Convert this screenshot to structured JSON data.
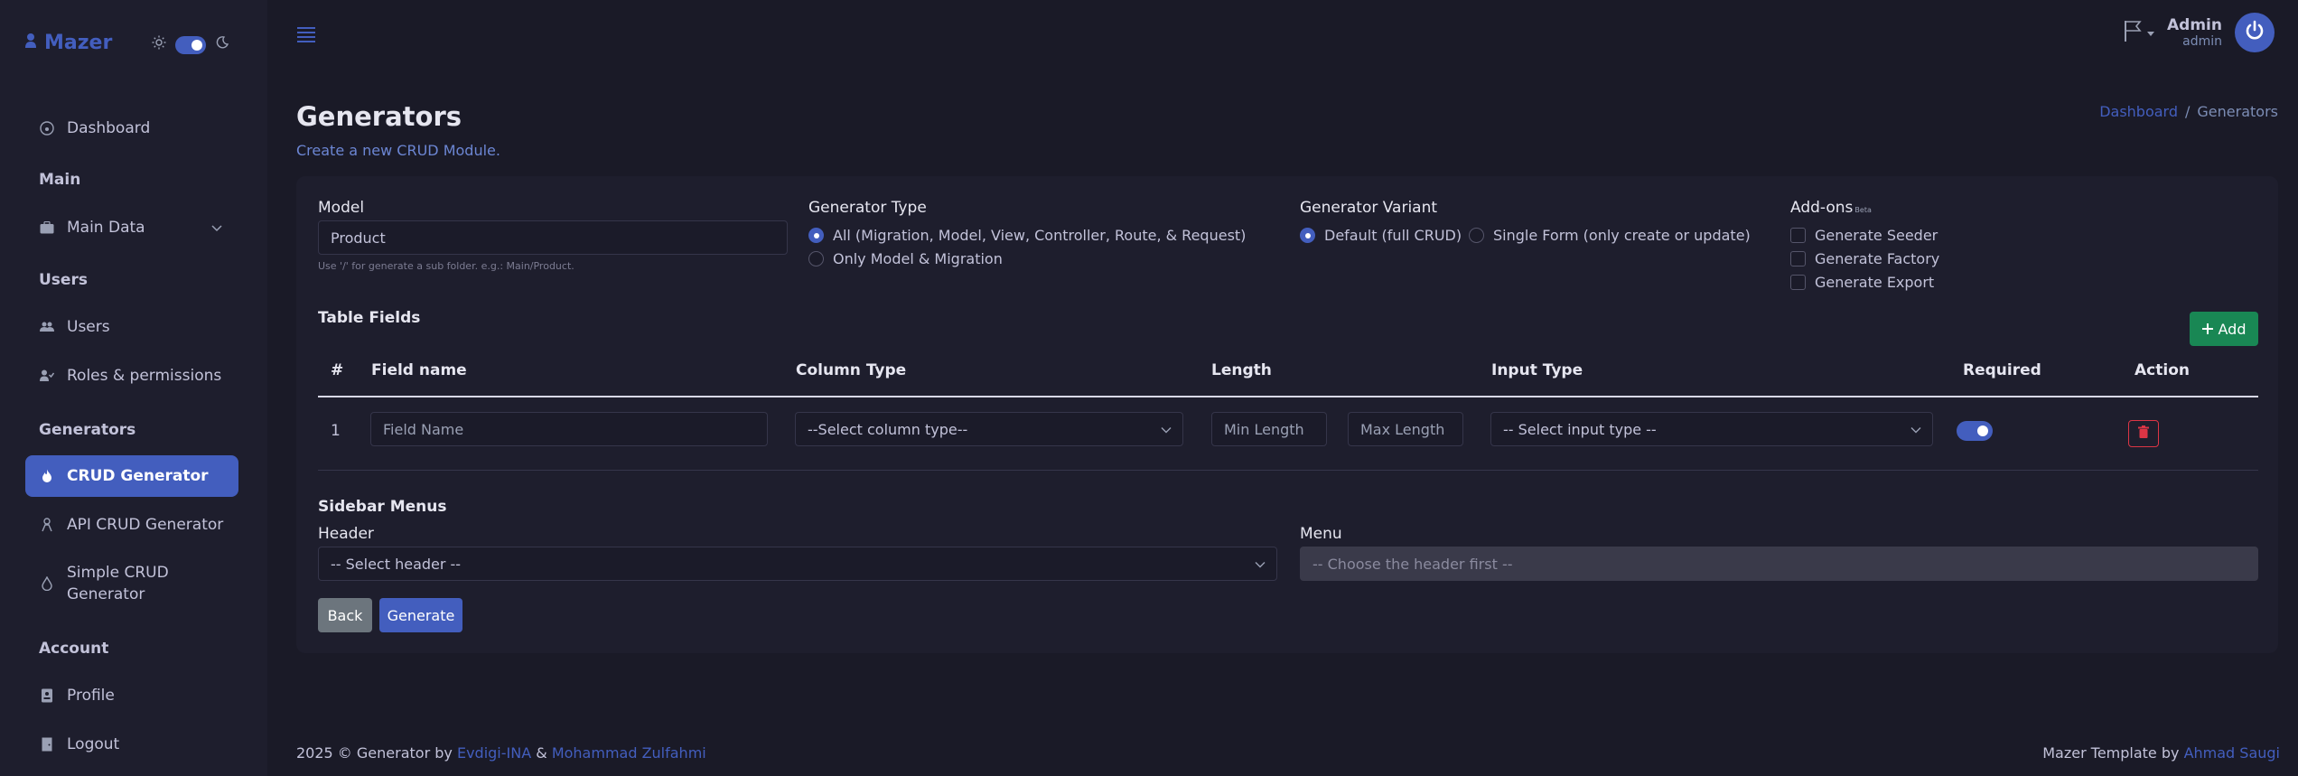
{
  "brand": {
    "name": "Mazer"
  },
  "sidebar": {
    "items": [
      {
        "label": "Dashboard"
      },
      {
        "title": "Main"
      },
      {
        "label": "Main Data"
      },
      {
        "title": "Users"
      },
      {
        "label": "Users"
      },
      {
        "label": "Roles & permissions"
      },
      {
        "title": "Generators"
      },
      {
        "label": "CRUD Generator"
      },
      {
        "label": "API CRUD Generator"
      },
      {
        "label": "Simple CRUD Generator"
      },
      {
        "title": "Account"
      },
      {
        "label": "Profile"
      },
      {
        "label": "Logout"
      }
    ]
  },
  "header": {
    "user_name": "Admin",
    "user_role": "admin"
  },
  "page": {
    "title": "Generators",
    "subtitle": "Create a new CRUD Module.",
    "breadcrumb": [
      "Dashboard",
      "/",
      "Generators"
    ]
  },
  "form": {
    "model_label": "Model",
    "model_value": "Product",
    "model_help": "Use '/' for generate a sub folder. e.g.: Main/Product.",
    "generator_type_label": "Generator Type",
    "generator_type_options": [
      "All (Migration, Model, View, Controller, Route, & Request)",
      "Only Model & Migration"
    ],
    "variant_label": "Generator Variant",
    "variant_options": [
      "Default (full CRUD)",
      "Single Form (only create or update)"
    ],
    "addons_label": "Add-ons",
    "addons_beta": "Beta",
    "addons_options": [
      "Generate Seeder",
      "Generate Factory",
      "Generate Export"
    ],
    "table_fields_title": "Table Fields",
    "add_label": "Add",
    "columns": [
      "#",
      "Field name",
      "Column Type",
      "Length",
      "Input Type",
      "Required",
      "Action"
    ],
    "row": {
      "num": "1",
      "field_placeholder": "Field Name",
      "column_type": "--Select column type--",
      "min_placeholder": "Min Length",
      "max_placeholder": "Max Length",
      "input_type": "-- Select input type --"
    },
    "sidebar_menus_title": "Sidebar Menus",
    "header_label": "Header",
    "header_select": "-- Select header --",
    "menu_label": "Menu",
    "menu_select": "-- Choose the header first --",
    "back_label": "Back",
    "generate_label": "Generate"
  },
  "footer": {
    "left_prefix": "2025 © Generator by",
    "left_link1": "Evdigi-INA",
    "left_amp": "&",
    "left_link2": "Mohammad Zulfahmi",
    "right_prefix": "Mazer Template by",
    "right_link": "Ahmad Saugi"
  },
  "colors": {
    "accent": "#435ebe",
    "success": "#198754",
    "danger": "#dc3545",
    "background": "#1a1a27",
    "sidebar": "#1e1e2d"
  }
}
